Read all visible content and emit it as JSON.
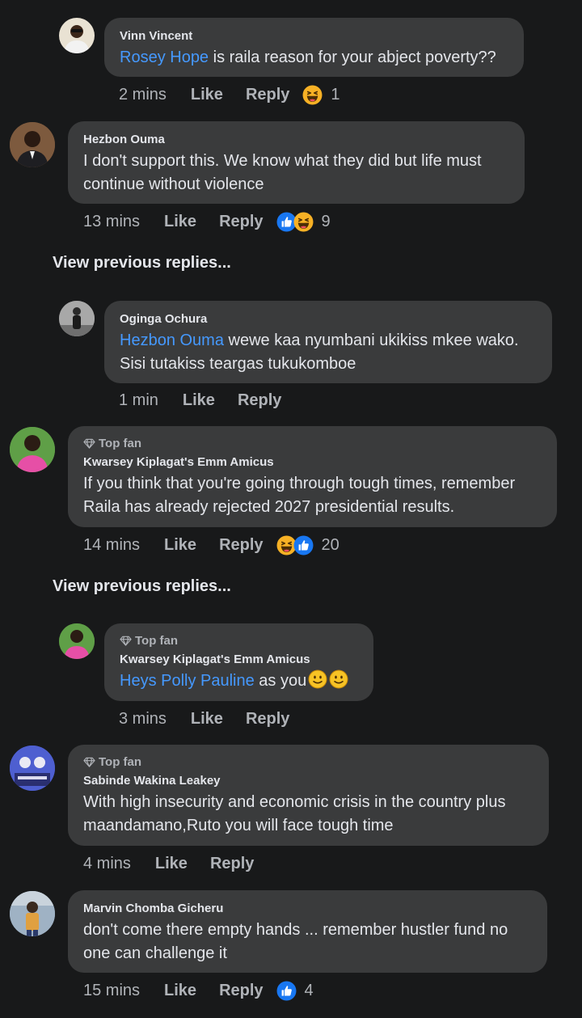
{
  "comments": [
    {
      "author": "Vinn Vincent",
      "mention": "Rosey Hope",
      "text": " is raila reason for your abject poverty??",
      "time": "2 mins",
      "like": "Like",
      "reply": "Reply",
      "reaction_count": "1"
    },
    {
      "author": "Hezbon Ouma",
      "text": "I don't support this. We know what they did but life must continue without violence",
      "time": "13 mins",
      "like": "Like",
      "reply": "Reply",
      "reaction_count": "9"
    },
    {
      "author": "Oginga Ochura",
      "mention": "Hezbon Ouma",
      "text": " wewe kaa nyumbani ukikiss mkee wako. Sisi tutakiss teargas tukukomboe",
      "time": "1 min",
      "like": "Like",
      "reply": "Reply"
    },
    {
      "badge": "Top fan",
      "author": "Kwarsey Kiplagat's Emm Amicus",
      "text": "If you think that you're going through tough times, remember Raila has already rejected 2027 presidential results.",
      "time": "14 mins",
      "like": "Like",
      "reply": "Reply",
      "reaction_count": "20"
    },
    {
      "badge": "Top fan",
      "author": "Kwarsey Kiplagat's Emm Amicus",
      "mention": "Heys Polly Pauline",
      "text": " as you",
      "time": "3 mins",
      "like": "Like",
      "reply": "Reply"
    },
    {
      "badge": "Top fan",
      "author": "Sabinde Wakina Leakey",
      "text": "With high insecurity and economic crisis in the country plus maandamano,Ruto you will face tough time",
      "time": "4 mins",
      "like": "Like",
      "reply": "Reply"
    },
    {
      "author": "Marvin Chomba Gicheru",
      "text": "don't come there empty hands ... remember hustler fund no one can challenge it",
      "time": "15 mins",
      "like": "Like",
      "reply": "Reply",
      "reaction_count": "4"
    }
  ],
  "view_previous_label": "View previous replies...",
  "colors": {
    "background": "#18191a",
    "bubble": "#3a3b3c",
    "mention": "#4599ff",
    "muted": "#b0b3b8",
    "like_blue": "#1877f2",
    "haha_yellow": "#f7b125"
  },
  "icons": [
    "diamond-icon",
    "haha-reaction-icon",
    "like-reaction-icon",
    "slightly-smiling-emoji"
  ]
}
